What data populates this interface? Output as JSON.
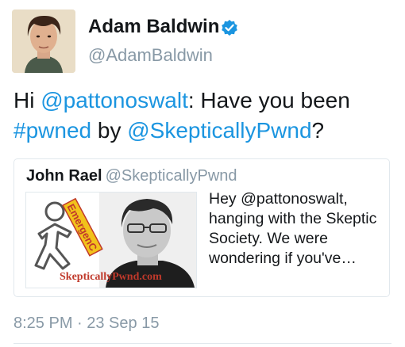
{
  "author": {
    "display_name": "Adam Baldwin",
    "username": "@AdamBaldwin",
    "verified_icon": "verified-badge-icon"
  },
  "tweet": {
    "text_parts": {
      "p1": "Hi ",
      "p2": "@pattonoswalt",
      "p3": ": Have you been",
      "p4": "#pwned",
      "p5": " by ",
      "p6": "@SkepticallyPwnd",
      "p7": "?"
    }
  },
  "quote": {
    "name": "John Rael",
    "handle": "@SkepticallyPwnd",
    "text": "Hey @pattonoswalt, hanging with the Skeptic Society. We were wondering if you've…",
    "media": {
      "stamp_text": "EmergenC",
      "watermark": "SkepticallyPwnd.com"
    }
  },
  "meta": {
    "timestamp": "8:25 PM · 23 Sep 15"
  },
  "colors": {
    "link": "#1b95e0",
    "secondary_text": "#8899a6",
    "primary_text": "#14171a",
    "border": "#e1e8ed"
  }
}
